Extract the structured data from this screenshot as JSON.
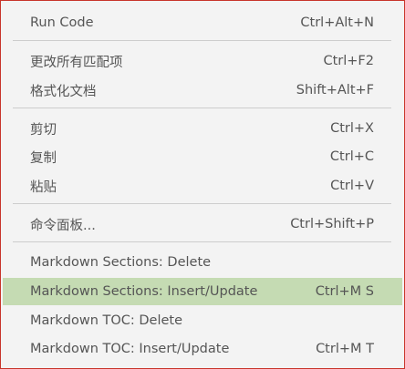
{
  "menu": {
    "items": [
      {
        "label": "Run Code",
        "shortcut": "Ctrl+Alt+N"
      },
      {
        "label": "更改所有匹配项",
        "shortcut": "Ctrl+F2"
      },
      {
        "label": "格式化文档",
        "shortcut": "Shift+Alt+F"
      },
      {
        "label": "剪切",
        "shortcut": "Ctrl+X"
      },
      {
        "label": "复制",
        "shortcut": "Ctrl+C"
      },
      {
        "label": "粘贴",
        "shortcut": "Ctrl+V"
      },
      {
        "label": "命令面板...",
        "shortcut": "Ctrl+Shift+P"
      },
      {
        "label": "Markdown Sections: Delete",
        "shortcut": ""
      },
      {
        "label": "Markdown Sections: Insert/Update",
        "shortcut": "Ctrl+M S",
        "highlighted": true
      },
      {
        "label": "Markdown TOC: Delete",
        "shortcut": ""
      },
      {
        "label": "Markdown TOC: Insert/Update",
        "shortcut": "Ctrl+M T"
      }
    ]
  },
  "colors": {
    "highlight": "#c5dbb3",
    "border": "#c8352b",
    "background": "#f3f3f3",
    "text": "#555555"
  }
}
